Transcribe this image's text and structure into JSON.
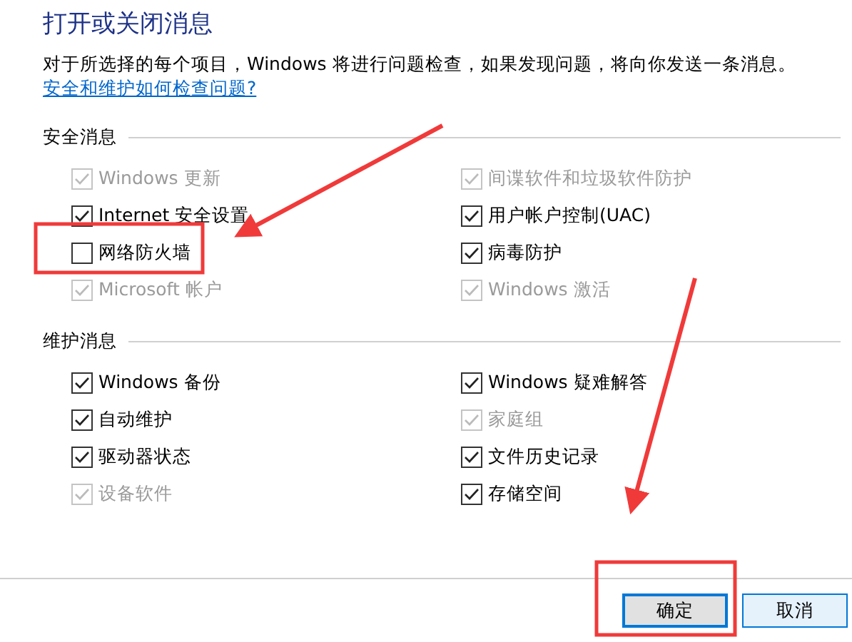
{
  "title": "打开或关闭消息",
  "description": "对于所选择的每个项目，Windows 将进行问题检查，如果发现问题，将向你发送一条消息。",
  "description_link": "安全和维护如何检查问题?",
  "sections": [
    {
      "heading": "安全消息",
      "items": [
        {
          "label": "Windows 更新",
          "checked": true,
          "disabled": true
        },
        {
          "label": "间谍软件和垃圾软件防护",
          "checked": true,
          "disabled": true
        },
        {
          "label": "Internet 安全设置",
          "checked": true,
          "disabled": false
        },
        {
          "label": "用户帐户控制(UAC)",
          "checked": true,
          "disabled": false
        },
        {
          "label": "网络防火墙",
          "checked": false,
          "disabled": false
        },
        {
          "label": "病毒防护",
          "checked": true,
          "disabled": false
        },
        {
          "label": "Microsoft 帐户",
          "checked": true,
          "disabled": true
        },
        {
          "label": "Windows 激活",
          "checked": true,
          "disabled": true
        }
      ]
    },
    {
      "heading": "维护消息",
      "items": [
        {
          "label": "Windows 备份",
          "checked": true,
          "disabled": false
        },
        {
          "label": "Windows 疑难解答",
          "checked": true,
          "disabled": false
        },
        {
          "label": "自动维护",
          "checked": true,
          "disabled": false
        },
        {
          "label": "家庭组",
          "checked": true,
          "disabled": true
        },
        {
          "label": "驱动器状态",
          "checked": true,
          "disabled": false
        },
        {
          "label": "文件历史记录",
          "checked": true,
          "disabled": false
        },
        {
          "label": "设备软件",
          "checked": true,
          "disabled": true
        },
        {
          "label": "存储空间",
          "checked": true,
          "disabled": false
        }
      ]
    }
  ],
  "buttons": [
    {
      "label": "确定",
      "kind": "primary"
    },
    {
      "label": "取消",
      "kind": "secondary"
    }
  ]
}
